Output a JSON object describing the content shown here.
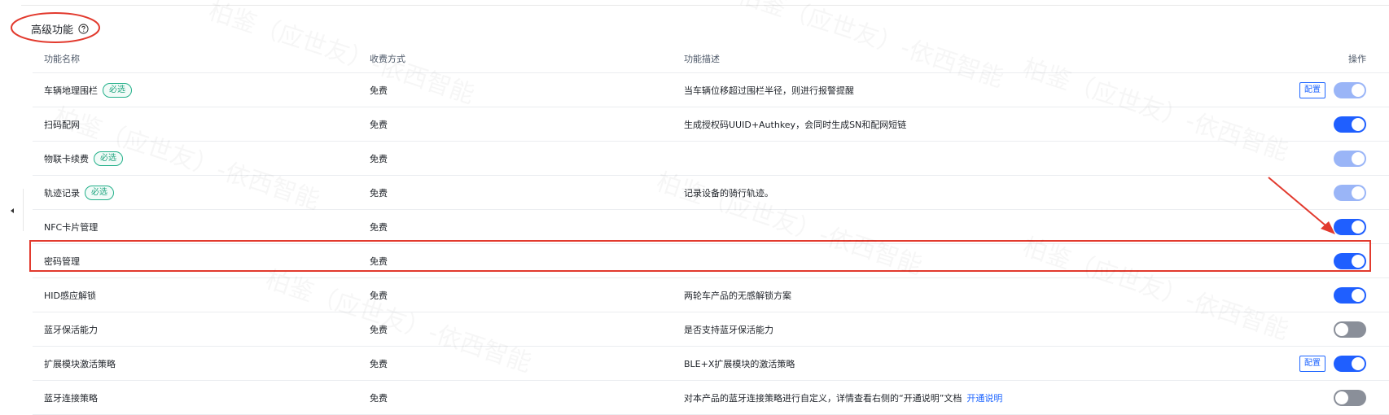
{
  "section": {
    "title": "高级功能"
  },
  "table": {
    "headers": {
      "name": "功能名称",
      "fee": "收费方式",
      "desc": "功能描述",
      "op": "操作"
    },
    "rows": [
      {
        "name": "车辆地理围栏",
        "tag": "必选",
        "fee": "免费",
        "desc": "当车辆位移超过围栏半径，则进行报警提醒",
        "link": "",
        "config": "配置",
        "toggle": "on-disabled"
      },
      {
        "name": "扫码配网",
        "tag": "",
        "fee": "免费",
        "desc": "生成授权码UUID+Authkey，会同时生成SN和配网短链",
        "link": "",
        "config": "",
        "toggle": "on"
      },
      {
        "name": "物联卡续费",
        "tag": "必选",
        "fee": "免费",
        "desc": "",
        "link": "",
        "config": "",
        "toggle": "on-disabled"
      },
      {
        "name": "轨迹记录",
        "tag": "必选",
        "fee": "免费",
        "desc": "记录设备的骑行轨迹。",
        "link": "",
        "config": "",
        "toggle": "on-disabled"
      },
      {
        "name": "NFC卡片管理",
        "tag": "",
        "fee": "免费",
        "desc": "",
        "link": "",
        "config": "",
        "toggle": "on"
      },
      {
        "name": "密码管理",
        "tag": "",
        "fee": "免费",
        "desc": "",
        "link": "",
        "config": "",
        "toggle": "on"
      },
      {
        "name": "HID感应解锁",
        "tag": "",
        "fee": "免费",
        "desc": "两轮车产品的无感解锁方案",
        "link": "",
        "config": "",
        "toggle": "on"
      },
      {
        "name": "蓝牙保活能力",
        "tag": "",
        "fee": "免费",
        "desc": "是否支持蓝牙保活能力",
        "link": "",
        "config": "",
        "toggle": "off"
      },
      {
        "name": "扩展模块激活策略",
        "tag": "",
        "fee": "免费",
        "desc": "BLE+X扩展模块的激活策略",
        "link": "",
        "config": "配置",
        "toggle": "on"
      },
      {
        "name": "蓝牙连接策略",
        "tag": "",
        "fee": "免费",
        "desc": "对本产品的蓝牙连接策略进行自定义，详情查看右侧的“开通说明”文档",
        "link": "开通说明",
        "config": "",
        "toggle": "off"
      }
    ]
  },
  "colors": {
    "primary": "#1f5fff",
    "annotation": "#e23a2e",
    "tag": "#23b08a"
  },
  "icons": {
    "help": "question-circle-icon",
    "collapse": "caret-left-icon"
  }
}
